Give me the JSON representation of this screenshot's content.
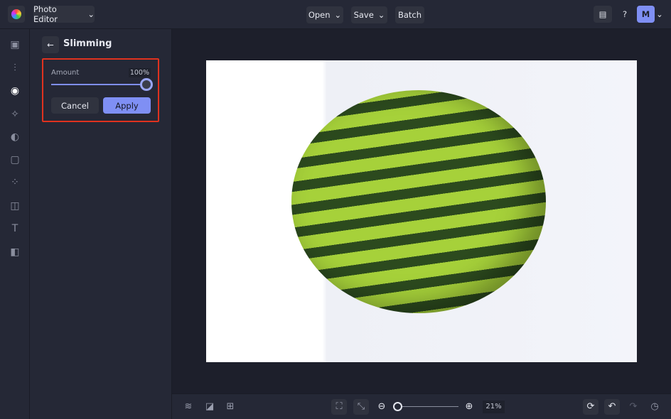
{
  "header": {
    "app_menu": "Photo Editor",
    "open": "Open",
    "save": "Save",
    "batch": "Batch",
    "avatar": "M"
  },
  "panel": {
    "title": "Slimming",
    "amount_label": "Amount",
    "amount_value": "100%",
    "amount_fraction": 1.0,
    "cancel": "Cancel",
    "apply": "Apply"
  },
  "footer": {
    "zoom": "21%"
  },
  "colors": {
    "accent": "#7f8ff4",
    "highlight": "#e0321f"
  }
}
